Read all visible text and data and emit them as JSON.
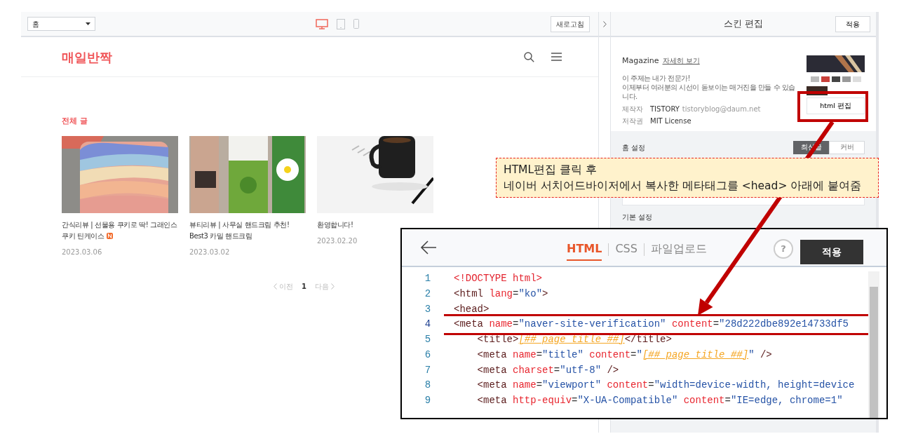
{
  "toolbar": {
    "page_select": "홈",
    "devices": [
      {
        "kind": "desktop",
        "selected": true
      },
      {
        "kind": "tablet",
        "selected": false
      },
      {
        "kind": "mobile",
        "selected": false
      }
    ],
    "refresh_button": "새로고침"
  },
  "blog": {
    "title": "매일반짝",
    "section_title": "전체 글",
    "posts": [
      {
        "title": "간식리뷰 | 선물용 쿠키로 딱! 그래인스 쿠키 틴케이스",
        "new_badge": true,
        "date": "2023.03.06"
      },
      {
        "title": "뷰티리뷰 | 사무실 핸드크림 추천! Best3 카밀 핸드크림",
        "new_badge": false,
        "date": "2023.03.02"
      },
      {
        "title": "환영합니다!",
        "new_badge": false,
        "date": "2023.02.20"
      }
    ],
    "pagination": {
      "prev": "이전",
      "pages": [
        {
          "label": "1",
          "selected": true
        }
      ],
      "next": "다음"
    }
  },
  "skin_panel": {
    "title": "스킨 편집",
    "apply_button": "적용",
    "skin": {
      "name": "Magazine",
      "details_link": "자세히 보기",
      "description": [
        "이 주제는 내가 전문가!",
        "이제부터 여러분의 시선이 돋보이는 매거진을 만들 수 있습니다."
      ],
      "meta": [
        {
          "label": "제작자",
          "value": "TISTORY",
          "extra": "tistoryblog@daum.net"
        },
        {
          "label": "저작권",
          "value": "MIT License"
        }
      ],
      "html_edit_button": "html 편집"
    },
    "home_settings": {
      "title": "홈 설정",
      "options": [
        {
          "label": "최신글",
          "selected": true
        },
        {
          "label": "커버",
          "selected": false
        }
      ]
    },
    "basic_settings": {
      "title": "기본 설정"
    }
  },
  "annotation": {
    "lines": [
      "HTML편집 클릭 후",
      "네이버 서치어드바이저에서 복사한 메타태그를 <head> 아래에 붙여줌"
    ]
  },
  "code_editor": {
    "tabs": [
      {
        "label": "HTML",
        "selected": true
      },
      {
        "label": "CSS",
        "selected": false
      },
      {
        "label": "파일업로드",
        "selected": false
      }
    ],
    "help_button": "?",
    "apply_button": "적용",
    "lines": [
      {
        "number": "1",
        "highlighted": false,
        "tokens": [
          {
            "kind": "doctype",
            "text": "<!DOCTYPE html>"
          }
        ]
      },
      {
        "number": "2",
        "highlighted": false,
        "tokens": [
          {
            "kind": "tag",
            "text": "<html"
          },
          {
            "kind": "attr",
            "text": " lang"
          },
          {
            "kind": "punct",
            "text": "="
          },
          {
            "kind": "string",
            "text": "\"ko\""
          },
          {
            "kind": "tag",
            "text": ">"
          }
        ]
      },
      {
        "number": "3",
        "highlighted": false,
        "tokens": [
          {
            "kind": "tag",
            "text": "<head>"
          }
        ]
      },
      {
        "number": "4",
        "highlighted": true,
        "tokens": [
          {
            "kind": "tag",
            "text": "<meta"
          },
          {
            "kind": "attr",
            "text": " name"
          },
          {
            "kind": "punct",
            "text": "="
          },
          {
            "kind": "string",
            "text": "\"naver-site-verification\""
          },
          {
            "kind": "attr",
            "text": " content"
          },
          {
            "kind": "punct",
            "text": "="
          },
          {
            "kind": "string",
            "text": "\"28d222dbe892e14733df5"
          }
        ]
      },
      {
        "number": "5",
        "highlighted": false,
        "tokens": [
          {
            "kind": "tag",
            "text": "    <title>"
          },
          {
            "kind": "placeholder",
            "text": "[##_page_title_##]"
          },
          {
            "kind": "tag",
            "text": "</title>"
          }
        ]
      },
      {
        "number": "6",
        "highlighted": false,
        "tokens": [
          {
            "kind": "tag",
            "text": "    <meta"
          },
          {
            "kind": "attr",
            "text": " name"
          },
          {
            "kind": "punct",
            "text": "="
          },
          {
            "kind": "string",
            "text": "\"title\""
          },
          {
            "kind": "attr",
            "text": " content"
          },
          {
            "kind": "punct",
            "text": "="
          },
          {
            "kind": "string",
            "text": "\""
          },
          {
            "kind": "placeholder",
            "text": "[##_page_title_##]"
          },
          {
            "kind": "string",
            "text": "\""
          },
          {
            "kind": "tag",
            "text": " />"
          }
        ]
      },
      {
        "number": "7",
        "highlighted": false,
        "tokens": [
          {
            "kind": "tag",
            "text": "    <meta"
          },
          {
            "kind": "attr",
            "text": " charset"
          },
          {
            "kind": "punct",
            "text": "="
          },
          {
            "kind": "string",
            "text": "\"utf-8\""
          },
          {
            "kind": "tag",
            "text": " />"
          }
        ]
      },
      {
        "number": "8",
        "highlighted": false,
        "tokens": [
          {
            "kind": "tag",
            "text": "    <meta"
          },
          {
            "kind": "attr",
            "text": " name"
          },
          {
            "kind": "punct",
            "text": "="
          },
          {
            "kind": "string",
            "text": "\"viewport\""
          },
          {
            "kind": "attr",
            "text": " content"
          },
          {
            "kind": "punct",
            "text": "="
          },
          {
            "kind": "string",
            "text": "\"width=device-width, height=device"
          }
        ]
      },
      {
        "number": "9",
        "highlighted": false,
        "tokens": [
          {
            "kind": "tag",
            "text": "    <meta"
          },
          {
            "kind": "attr",
            "text": " http-equiv"
          },
          {
            "kind": "punct",
            "text": "="
          },
          {
            "kind": "string",
            "text": "\"X-UA-Compatible\""
          },
          {
            "kind": "attr",
            "text": " content"
          },
          {
            "kind": "punct",
            "text": "="
          },
          {
            "kind": "string",
            "text": "\"IE=edge, chrome=1\""
          }
        ]
      }
    ]
  }
}
